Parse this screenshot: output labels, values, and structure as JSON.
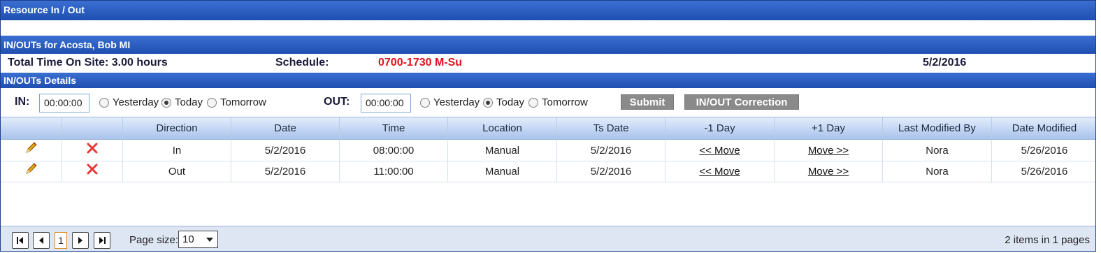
{
  "title": "Resource In / Out",
  "section": {
    "header": "IN/OUTs for Acosta, Bob MI"
  },
  "summary": {
    "total_time": "Total Time On Site: 3.00 hours",
    "schedule_label": "Schedule:",
    "schedule_value": "0700-1730 M-Su",
    "date": "5/2/2016"
  },
  "details": {
    "header": "IN/OUTs Details"
  },
  "in_out_form": {
    "in_label": "IN:",
    "in_value": "00:00:00",
    "out_label": "OUT:",
    "out_value": "00:00:00",
    "options": [
      "Yesterday",
      "Today",
      "Tomorrow"
    ],
    "in_selected": "Today",
    "out_selected": "Today",
    "submit_label": "Submit",
    "correction_label": "IN/OUT Correction"
  },
  "grid": {
    "columns": [
      "",
      "",
      "Direction",
      "Date",
      "Time",
      "Location",
      "Ts Date",
      "-1 Day",
      "+1 Day",
      "Last Modified By",
      "Date Modified"
    ],
    "rows": [
      {
        "direction": "In",
        "date": "5/2/2016",
        "time": "08:00:00",
        "location": "Manual",
        "ts_date": "5/2/2016",
        "minus_day": "<< Move",
        "plus_day": "Move >>",
        "modified_by": "Nora",
        "date_modified": "5/26/2016"
      },
      {
        "direction": "Out",
        "date": "5/2/2016",
        "time": "11:00:00",
        "location": "Manual",
        "ts_date": "5/2/2016",
        "minus_day": "<< Move",
        "plus_day": "Move >>",
        "modified_by": "Nora",
        "date_modified": "5/26/2016"
      }
    ],
    "row_icons": {
      "edit": "pencil-icon",
      "delete": "delete-x-icon"
    }
  },
  "pager": {
    "current_page": "1",
    "page_size_label": "Page size:",
    "page_size_value": "10",
    "items_text": "2 items in 1 pages"
  },
  "colors": {
    "header_bar": "#2553b8",
    "schedule_value": "#e0101c",
    "button": "#8a8a8a",
    "grid_header": "#a9c3ec",
    "footer": "#dde6f2"
  }
}
